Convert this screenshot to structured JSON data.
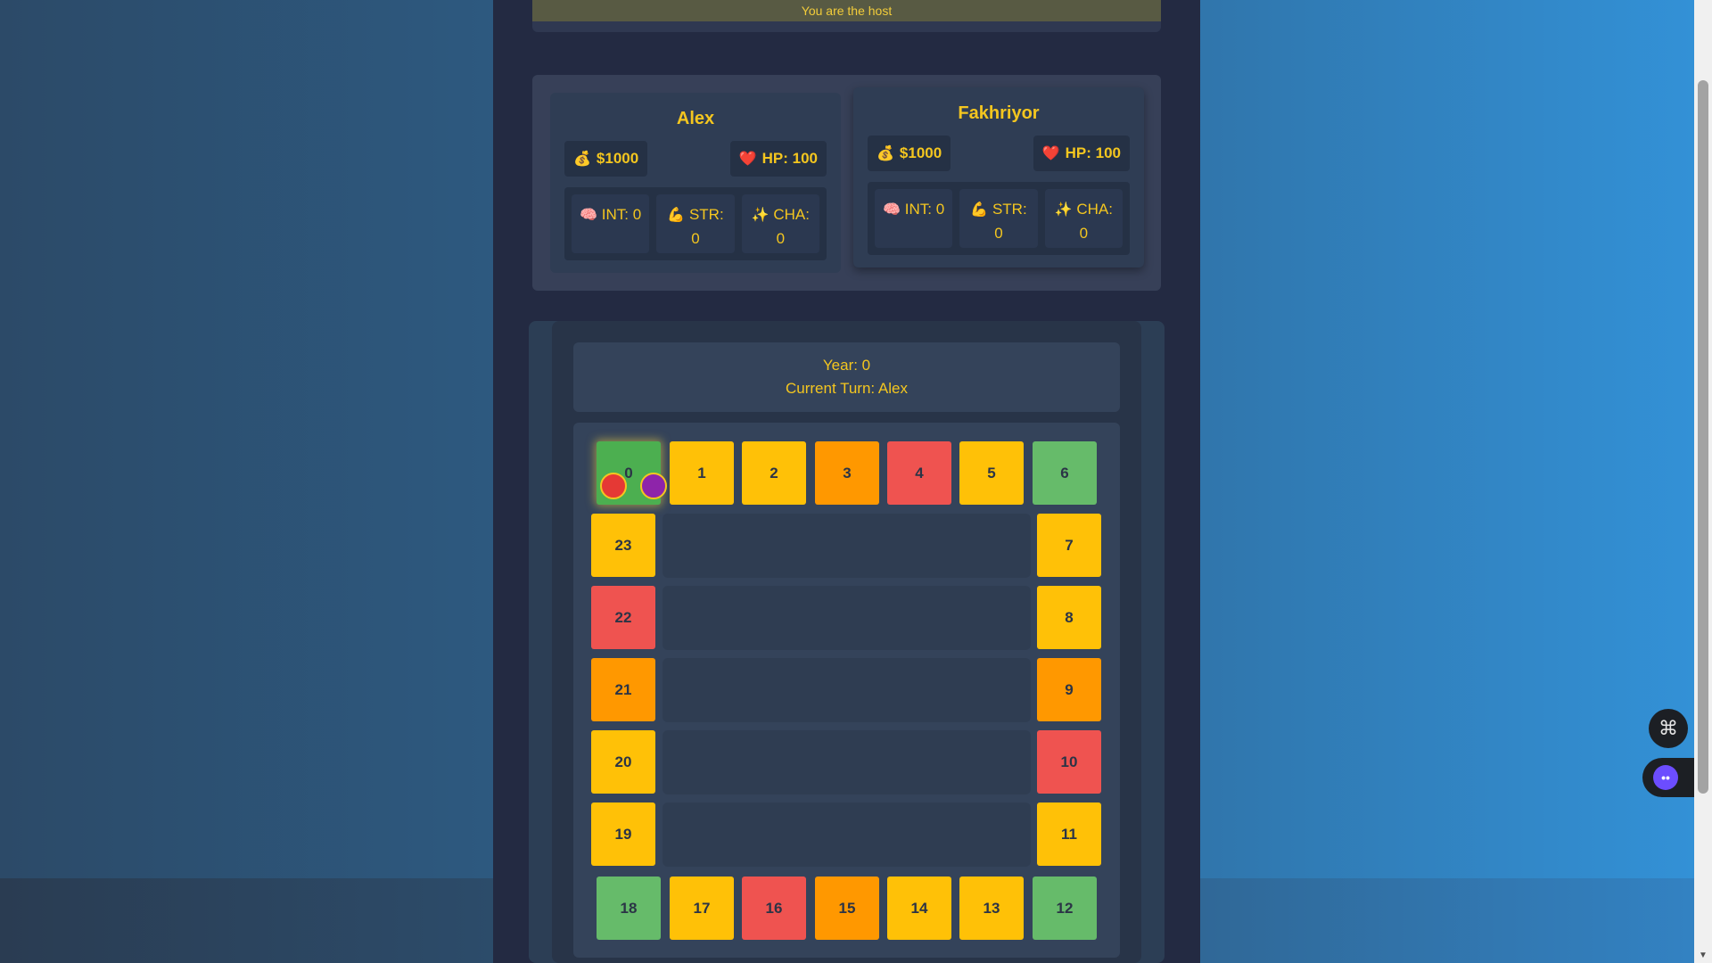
{
  "host_banner": {
    "text": "You are the host"
  },
  "players": [
    {
      "name": "Alex",
      "money": "$1000",
      "hp": "HP: 100",
      "int": "INT: 0",
      "str_label": "STR:",
      "str_value": "0",
      "cha_label": "CHA:",
      "cha_value": "0"
    },
    {
      "name": "Fakhriyor",
      "money": "$1000",
      "hp": "HP: 100",
      "int": "INT: 0",
      "str_label": "STR:",
      "str_value": "0",
      "cha_label": "CHA:",
      "cha_value": "0"
    }
  ],
  "icons": {
    "money": "money-bag-icon",
    "hp": "heart-icon",
    "int": "brain-icon",
    "str": "flexed-biceps-icon",
    "cha": "sparkles-icon"
  },
  "game_info": {
    "year": "Year: 0",
    "current_turn": "Current Turn: Alex"
  },
  "board": {
    "tiles": [
      {
        "n": "0",
        "color": "start"
      },
      {
        "n": "1",
        "color": "yellow"
      },
      {
        "n": "2",
        "color": "yellow"
      },
      {
        "n": "3",
        "color": "orange"
      },
      {
        "n": "4",
        "color": "red"
      },
      {
        "n": "5",
        "color": "yellow"
      },
      {
        "n": "6",
        "color": "green"
      },
      {
        "n": "7",
        "color": "yellow"
      },
      {
        "n": "8",
        "color": "yellow"
      },
      {
        "n": "9",
        "color": "orange"
      },
      {
        "n": "10",
        "color": "red"
      },
      {
        "n": "11",
        "color": "yellow"
      },
      {
        "n": "12",
        "color": "green"
      },
      {
        "n": "13",
        "color": "yellow"
      },
      {
        "n": "14",
        "color": "yellow"
      },
      {
        "n": "15",
        "color": "orange"
      },
      {
        "n": "16",
        "color": "red"
      },
      {
        "n": "17",
        "color": "yellow"
      },
      {
        "n": "18",
        "color": "green"
      },
      {
        "n": "19",
        "color": "yellow"
      },
      {
        "n": "20",
        "color": "yellow"
      },
      {
        "n": "21",
        "color": "orange"
      },
      {
        "n": "22",
        "color": "red"
      },
      {
        "n": "23",
        "color": "yellow"
      }
    ],
    "tokens": [
      {
        "player": "Alex",
        "color": "#e53935",
        "position": 0
      },
      {
        "player": "Fakhriyor",
        "color": "#8e24aa",
        "position": 0
      }
    ]
  },
  "colors": {
    "tile_green": "#66bb6a",
    "tile_yellow": "#ffc107",
    "tile_orange": "#ff9800",
    "tile_red": "#ef5350",
    "accent_text": "#f4c61f"
  }
}
